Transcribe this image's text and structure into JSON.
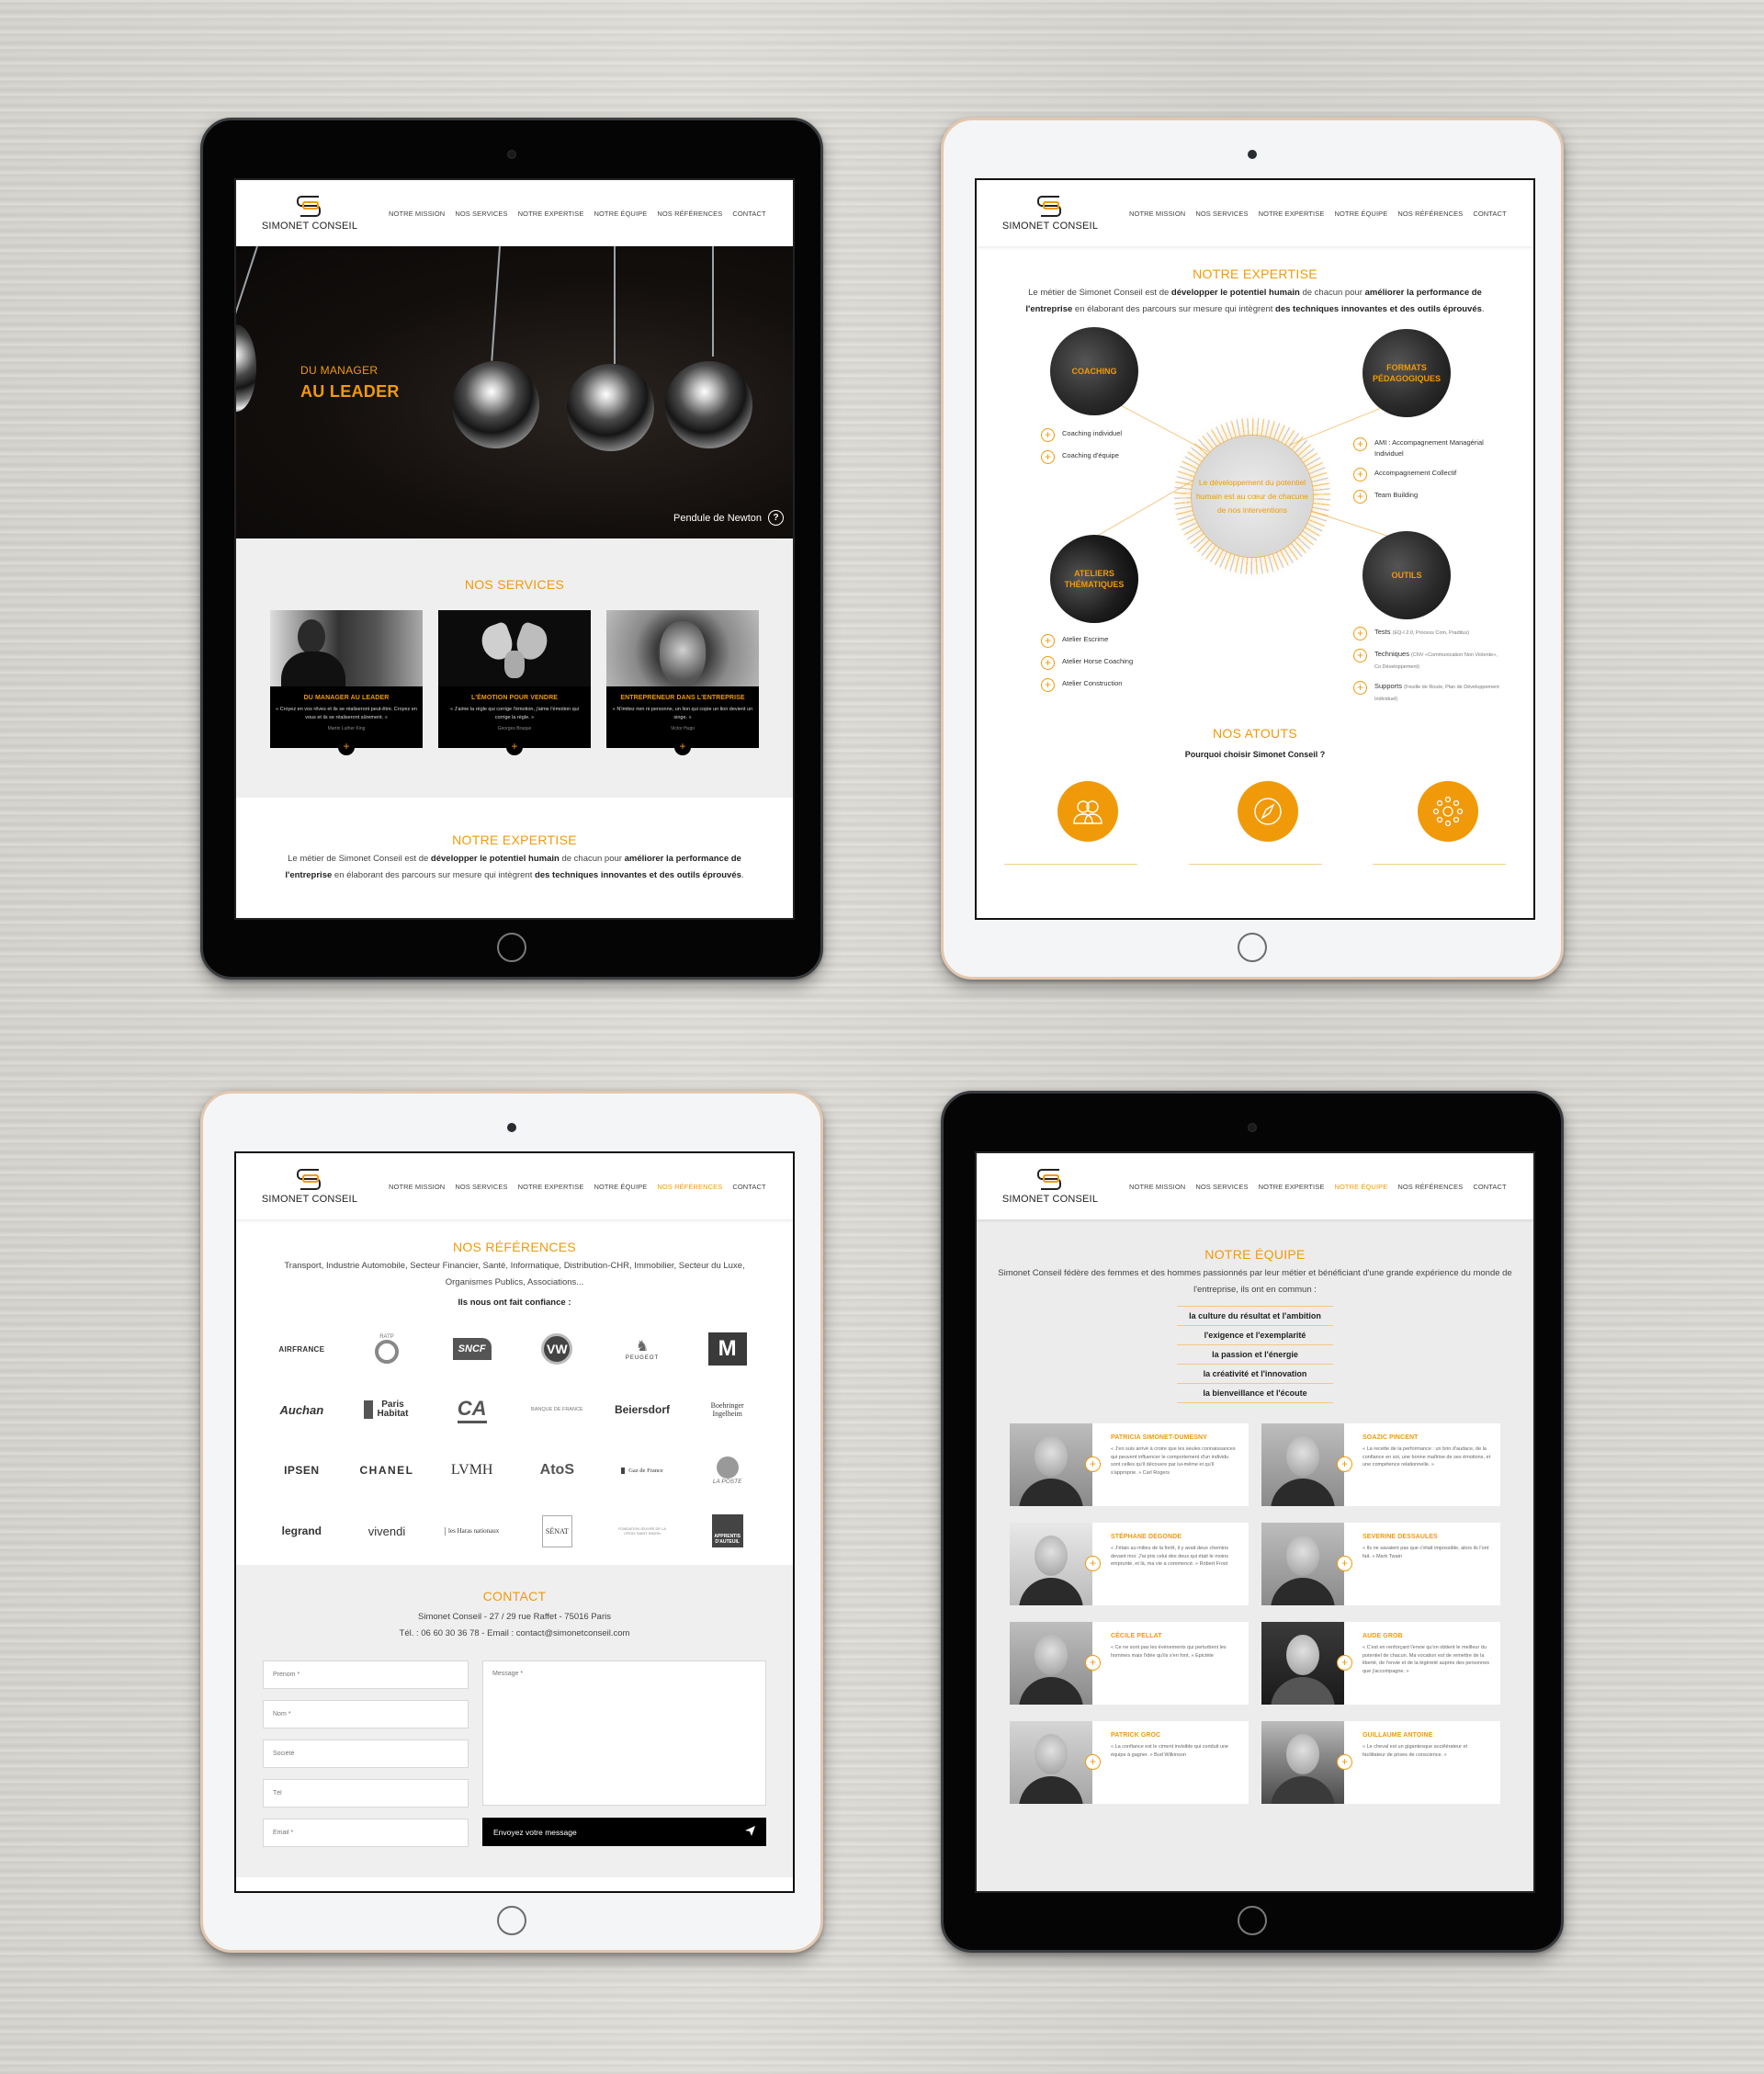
{
  "brand": {
    "name": "SIMONET CONSEIL",
    "accent_color": "#f09a0a"
  },
  "nav": {
    "items": [
      "NOTRE MISSION",
      "NOS SERVICES",
      "NOTRE EXPERTISE",
      "NOTRE ÉQUIPE",
      "NOS RÉFÉRENCES",
      "CONTACT"
    ]
  },
  "tablet1": {
    "hero": {
      "subtitle": "DU MANAGER",
      "title": "AU LEADER",
      "caption": "Pendule de Newton",
      "caption_icon": "question-circle-icon"
    },
    "services": {
      "title": "NOS SERVICES",
      "cards": [
        {
          "title": "DU MANAGER AU LEADER",
          "quote": "« Croyez en vos rêves et ils se réaliseront peut-être. Croyez en vous et ils se réaliseront sûrement. »",
          "author": "Martin Luther King"
        },
        {
          "title": "L'ÉMOTION POUR VENDRE",
          "quote": "« J'aime la règle qui corrige l'émotion, j'aime l'émotion qui corrige la règle. »",
          "author": "Georges Braque"
        },
        {
          "title": "ENTREPRENEUR DANS L'ENTREPRISE",
          "quote": "« N'imitez rien ni personne, un lion qui copie un lion devient un singe. »",
          "author": "Victor Hugo"
        }
      ]
    },
    "expertise": {
      "title": "NOTRE EXPERTISE",
      "text_parts": [
        "Le métier de Simonet Conseil est de ",
        "développer le potentiel humain",
        " de chacun pour ",
        "améliorer la performance de l'entreprise",
        " en élaborant des parcours sur mesure qui intègrent ",
        "des techniques innovantes et des outils éprouvés",
        "."
      ]
    }
  },
  "tablet2": {
    "expertise": {
      "title": "NOTRE EXPERTISE",
      "text_parts": [
        "Le métier de Simonet Conseil est de ",
        "développer le potentiel humain",
        " de chacun pour ",
        "améliorer la performance de l'entreprise",
        " en élaborant des parcours sur mesure qui intègrent ",
        "des techniques innovantes et des outils éprouvés",
        "."
      ]
    },
    "center_text": "Le développement du potentiel humain est au cœur de chacune de nos interventions",
    "categories": [
      {
        "title": "COACHING",
        "items": [
          {
            "label": "Coaching individuel",
            "detail": ""
          },
          {
            "label": "Coaching d'équipe",
            "detail": ""
          }
        ]
      },
      {
        "title": "FORMATS PÉDAGOGIQUES",
        "items": [
          {
            "label": "AMI : Accompagnement Managérial Individuel",
            "detail": ""
          },
          {
            "label": "Accompagnement Collectif",
            "detail": ""
          },
          {
            "label": "Team Building",
            "detail": ""
          }
        ]
      },
      {
        "title": "ATELIERS THÉMATIQUES",
        "items": [
          {
            "label": "Atelier Escrime",
            "detail": ""
          },
          {
            "label": "Atelier Horse Coaching",
            "detail": ""
          },
          {
            "label": "Atelier Construction",
            "detail": ""
          }
        ]
      },
      {
        "title": "OUTILS",
        "items": [
          {
            "label": "Tests",
            "detail": "(EQ-I 2.0, Process Com, Praditus)"
          },
          {
            "label": "Techniques",
            "detail": "(CNV «Communication Non Violente», Co Développement)"
          },
          {
            "label": "Supports",
            "detail": "(Feuille de Route, Plan de Développement Individuel)"
          }
        ]
      }
    ],
    "atouts": {
      "title": "NOS ATOUTS",
      "subtitle": "Pourquoi choisir Simonet Conseil ?",
      "icons": [
        "people-icon",
        "compass-icon",
        "network-circles-icon"
      ]
    }
  },
  "tablet3": {
    "references": {
      "title": "NOS RÉFÉRENCES",
      "sectors": "Transport, Industrie Automobile, Secteur Financier, Santé, Informatique, Distribution-CHR, Immobilier, Secteur du Luxe, Organismes Publics, Associations...",
      "trust_label": "Ils nous ont fait confiance :",
      "logos": [
        "AIRFRANCE",
        "RATP",
        "SNCF",
        "VW",
        "PEUGEOT",
        "M",
        "Auchan",
        "Paris Habitat",
        "CA",
        "BANQUE DE FRANCE",
        "Beiersdorf",
        "Boehringer Ingelheim",
        "IPSEN",
        "CHANEL",
        "LVMH",
        "AtoS",
        "Gaz de France",
        "LA POSTE",
        "legrand",
        "vivendi",
        "les Haras nationaux",
        "SÉNAT",
        "FONDATION ŒUVRE DE LA CROIX SAINT-SIMON",
        "APPRENTIS D'AUTEUIL"
      ]
    },
    "contact": {
      "title": "CONTACT",
      "address": "Simonet Conseil - 27 / 29 rue Raffet - 75016 Paris",
      "phone_email": "Tél. : 06 60 30 36 78 - Email : contact@simonetconseil.com",
      "fields": {
        "firstname_placeholder": "Prénom *",
        "lastname_placeholder": "Nom *",
        "company_placeholder": "Société",
        "phone_placeholder": "Tél",
        "email_placeholder": "Email *",
        "message_placeholder": "Message *"
      },
      "send_label": "Envoyez votre message"
    }
  },
  "tablet4": {
    "team": {
      "title": "NOTRE ÉQUIPE",
      "intro": "Simonet Conseil fédère des femmes et des hommes passionnés par leur métier et bénéficiant d'une grande expérience du monde de l'entreprise, ils ont en commun :",
      "values": [
        "la culture du résultat et l'ambition",
        "l'exigence et l'exemplarité",
        "la passion et l'énergie",
        "la créativité et l'innovation",
        "la bienveillance et l'écoute"
      ],
      "members": [
        {
          "name": "PATRICIA SIMONET-DUMESNY",
          "quote": "« J'en suis arrivé à croire que les seules connaissances qui peuvent influencer le comportement d'un individu sont celles qu'il découvre par lui-même et qu'il s'approprie. » Carl Rogers"
        },
        {
          "name": "SOAZIC PINCENT",
          "quote": "« La recette de la performance : un brin d'audace, de la confiance en soi, une bonne maîtrise de ses émotions, et une compétence relationnelle. »"
        },
        {
          "name": "STÉPHANE DEGONDE",
          "quote": "« J'étais au milieu de la forêt, il y avait deux chemins devant moi. J'ai pris celui des deux qui était le moins emprunté, et là, ma vie a commencé. » Robert Frost"
        },
        {
          "name": "SEVERINE DESSAULES",
          "quote": "« Ils ne savaient pas que c'était impossible, alors ils l'ont fait. » Mark Twain"
        },
        {
          "name": "CÉCILE PELLAT",
          "quote": "« Ce ne sont pas les évènements qui perturbent les hommes mais l'idée qu'ils s'en font. » Epictète"
        },
        {
          "name": "AUDE GROB",
          "quote": "« C'est en renforçant l'envie qu'on obtient le meilleur du potentiel de chacun. Ma vocation est de remettre de la liberté, de l'envie et de la légèreté auprès des personnes que j'accompagne. »"
        },
        {
          "name": "PATRICK GROC",
          "quote": "« La confiance est le ciment invisible qui conduit une équipe à gagner. » Bud Wilkinson"
        },
        {
          "name": "GUILLAUME ANTOINE",
          "quote": "« Le cheval est un gigantesque accélérateur et facilitateur de prises de conscience. »"
        }
      ]
    }
  }
}
